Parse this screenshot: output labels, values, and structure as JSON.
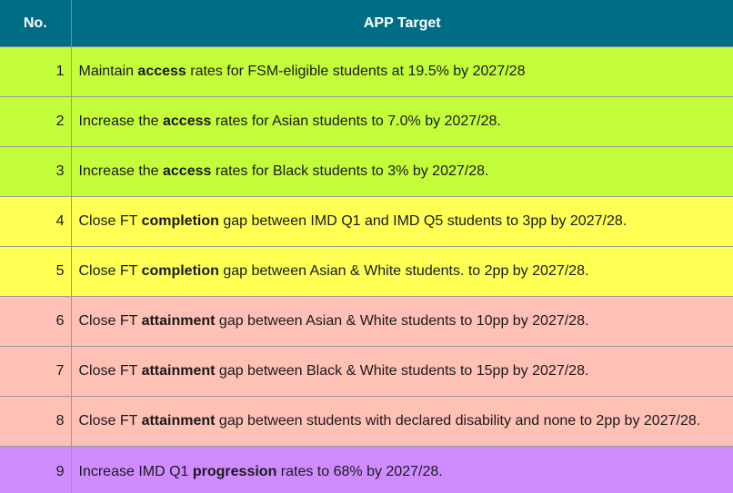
{
  "table": {
    "headers": {
      "no": "No.",
      "target": "APP Target"
    },
    "category_colors": {
      "header": "#006d87",
      "access": "#c4fd3a",
      "completion": "#ffff54",
      "attainment": "#ffc0b6",
      "progression": "#ce8cff"
    },
    "rows": [
      {
        "no": "1",
        "category": "access",
        "pre": "Maintain ",
        "bold": "access",
        "post": " rates for FSM-eligible students at 19.5% by 2027/28"
      },
      {
        "no": "2",
        "category": "access",
        "pre": "Increase the ",
        "bold": "access",
        "post": " rates for Asian students to 7.0% by 2027/28."
      },
      {
        "no": "3",
        "category": "access",
        "pre": "Increase the ",
        "bold": "access",
        "post": " rates for Black students to 3% by 2027/28."
      },
      {
        "no": "4",
        "category": "completion",
        "pre": "Close FT ",
        "bold": "completion",
        "post": " gap between IMD Q1 and IMD Q5 students to 3pp by 2027/28."
      },
      {
        "no": "5",
        "category": "completion",
        "pre": "Close FT ",
        "bold": "completion",
        "post": " gap between Asian & White students. to 2pp by 2027/28."
      },
      {
        "no": "6",
        "category": "attainment",
        "pre": "Close FT ",
        "bold": "attainment",
        "post": " gap between Asian & White students to 10pp by 2027/28."
      },
      {
        "no": "7",
        "category": "attainment",
        "pre": "Close FT ",
        "bold": "attainment",
        "post": " gap between Black & White students to 15pp by 2027/28."
      },
      {
        "no": "8",
        "category": "attainment",
        "pre": "Close FT ",
        "bold": "attainment",
        "post": " gap between students with declared disability and none to 2pp by 2027/28."
      },
      {
        "no": "9",
        "category": "progression",
        "pre": "Increase IMD Q1 ",
        "bold": "progression",
        "post": " rates to 68% by 2027/28."
      }
    ]
  }
}
